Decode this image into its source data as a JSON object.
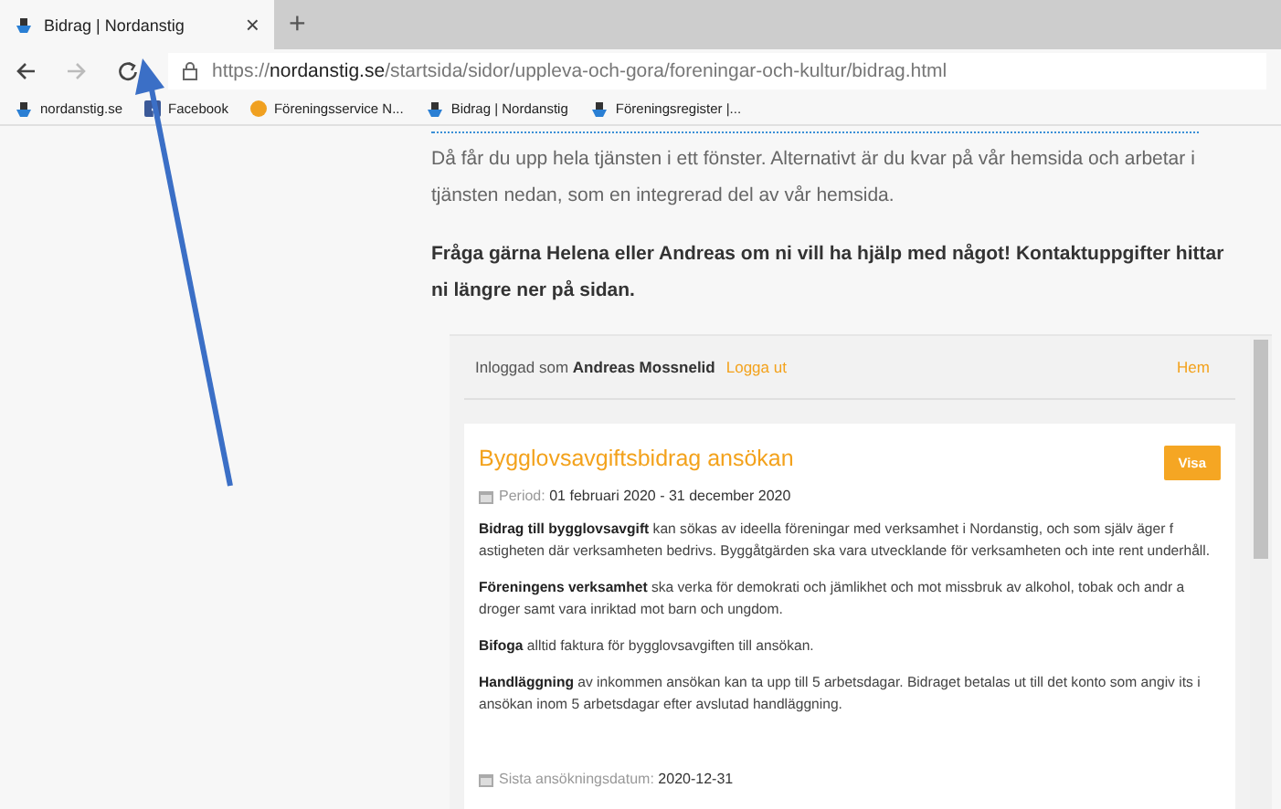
{
  "browser": {
    "tab": {
      "title": "Bidrag | Nordanstig",
      "close": "×",
      "new_tab": "+"
    },
    "address": {
      "scheme": "https://",
      "domain": "nordanstig.se",
      "path": "/startsida/sidor/uppleva-och-gora/foreningar-och-kultur/bidrag.html"
    },
    "bookmarks": [
      {
        "label": "nordanstig.se",
        "kind": "site"
      },
      {
        "label": "Facebook",
        "kind": "facebook"
      },
      {
        "label": "Föreningsservice N...",
        "kind": "service"
      },
      {
        "label": "Bidrag | Nordanstig",
        "kind": "site"
      },
      {
        "label": "Föreningsregister |...",
        "kind": "site"
      }
    ]
  },
  "intro": {
    "paragraph": "Då får du upp hela tjänsten i ett fönster. Alternativt är du kvar på vår hemsida och arbetar i tjänsten nedan, som en integrerad del av vår hemsida.",
    "bold_paragraph": "Fråga gärna Helena eller Andreas om ni vill ha hjälp med något! Kontaktuppgifter hittar ni längre ner på sidan."
  },
  "service": {
    "login": {
      "prefix": "Inloggad som",
      "user": "Andreas Mossnelid",
      "logout": "Logga ut",
      "home": "Hem"
    },
    "card": {
      "title": "Bygglovsavgiftsbidrag ansökan",
      "button": "Visa",
      "period_label": "Period:",
      "period": "01 februari 2020 - 31 december 2020",
      "paragraphs": [
        "**Bidrag till bygglovsavgift** kan sökas av ideella föreningar med verksamhet i Nordanstig, och som själv äger f astigheten där verksamheten bedrivs. Byggåtgärden ska vara utvecklande för verksamheten och inte rent underhåll.",
        "**Föreningens verksamhet** ska verka för demokrati och jämlikhet och mot missbruk av alkohol, tobak och andr a droger samt vara inriktad mot barn och ungdom.",
        "**Bifoga** alltid faktura för bygglovsavgiften till ansökan.",
        "**Handläggning** av inkommen ansökan kan ta upp till 5 arbetsdagar. Bidraget betalas ut till det konto som angiv its i ansökan inom 5 arbetsdagar efter avslutad handläggning."
      ],
      "deadline_label": "Sista ansökningsdatum:",
      "deadline": "2020-12-31"
    }
  }
}
